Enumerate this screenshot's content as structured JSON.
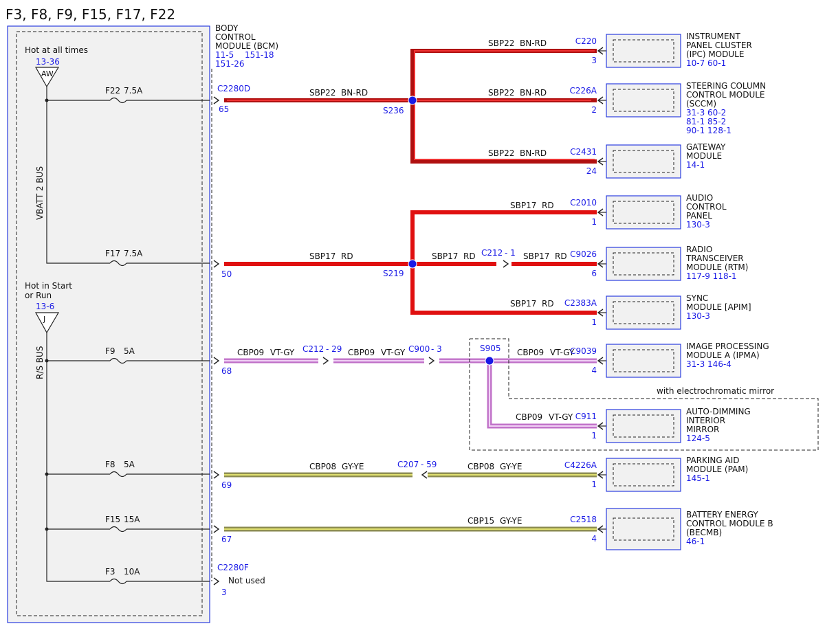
{
  "title": "F3, F8, F9, F15, F17, F22",
  "colors": {
    "wire_red_dark": "#b01010",
    "wire_red": "#e01010",
    "wire_vtgy": "#c070c8",
    "wire_gyye": "#9a9a3a",
    "splice": "#1a1ae6",
    "link": "#1a1ae6",
    "box_border": "#2b3ee0"
  },
  "fusebox": {
    "hot_at_all_times": "Hot at all times",
    "hot_at_all_times_ref": "13-36",
    "aw": "AW",
    "vbatt_bus": "VBATT 2 BUS",
    "hot_start_line1": "Hot in Start",
    "hot_start_line2": "or Run",
    "hot_start_ref": "13-6",
    "j": "J",
    "rs_bus": "R/S BUS"
  },
  "fuses": [
    {
      "name": "F22",
      "rating": "7.5A"
    },
    {
      "name": "F17",
      "rating": "7.5A"
    },
    {
      "name": "F9",
      "rating": "5A"
    },
    {
      "name": "F8",
      "rating": "5A"
    },
    {
      "name": "F15",
      "rating": "15A"
    },
    {
      "name": "F3",
      "rating": "10A"
    }
  ],
  "bcm": {
    "l1": "BODY",
    "l2": "CONTROL",
    "l3": "MODULE (BCM)",
    "ref1": "11-5",
    "ref2": "151-18",
    "ref3": "151-26",
    "conn_d": "C2280D",
    "conn_f": "C2280F",
    "not_used": "Not used",
    "pins": [
      "65",
      "50",
      "68",
      "69",
      "67",
      "3"
    ]
  },
  "wires": {
    "sbp22": "SBP22",
    "bnrd": "BN-RD",
    "sbp17": "SBP17",
    "rd": "RD",
    "cbp09": "CBP09",
    "vtgy": "VT-GY",
    "cbp08": "CBP08",
    "gyye": "GY-YE",
    "cbp15": "CBP15"
  },
  "splices": {
    "s236": "S236",
    "s219": "S219",
    "s905": "S905"
  },
  "inline": {
    "c212": "C212",
    "c212_pin1": "- 1",
    "c212_pin29": "- 29",
    "c900": "C900",
    "c900_pin": "- 3",
    "c207": "C207",
    "c207_pin": "- 59"
  },
  "option_note": "with electrochromatic mirror",
  "modules": [
    {
      "conn": "C220",
      "pin": "3",
      "lines": [
        "INSTRUMENT",
        "PANEL CLUSTER",
        "(IPC) MODULE"
      ],
      "refs": [
        "10-7   60-1"
      ]
    },
    {
      "conn": "C226A",
      "pin": "2",
      "lines": [
        "STEERING COLUMN",
        "CONTROL MODULE",
        "(SCCM)"
      ],
      "refs": [
        "31-3    60-2",
        "81-1    85-2",
        "90-1   128-1"
      ]
    },
    {
      "conn": "C2431",
      "pin": "24",
      "lines": [
        "GATEWAY",
        "MODULE"
      ],
      "refs": [
        "14-1"
      ]
    },
    {
      "conn": "C2010",
      "pin": "1",
      "lines": [
        "AUDIO",
        "CONTROL",
        "PANEL"
      ],
      "refs": [
        "130-3"
      ]
    },
    {
      "conn": "C9026",
      "pin": "6",
      "lines": [
        "RADIO",
        "TRANSCEIVER",
        "MODULE (RTM)"
      ],
      "refs": [
        "117-9  118-1"
      ]
    },
    {
      "conn": "C2383A",
      "pin": "1",
      "lines": [
        "SYNC",
        "MODULE [APIM]"
      ],
      "refs": [
        "130-3"
      ]
    },
    {
      "conn": "C9039",
      "pin": "4",
      "lines": [
        "IMAGE PROCESSING",
        "MODULE A (IPMA)"
      ],
      "refs": [
        "31-3    146-4"
      ]
    },
    {
      "conn": "C911",
      "pin": "1",
      "lines": [
        "AUTO-DIMMING",
        "INTERIOR",
        "MIRROR"
      ],
      "refs": [
        "124-5"
      ]
    },
    {
      "conn": "C4226A",
      "pin": "1",
      "lines": [
        "PARKING AID",
        "MODULE (PAM)"
      ],
      "refs": [
        "145-1"
      ]
    },
    {
      "conn": "C2518",
      "pin": "4",
      "lines": [
        "BATTERY ENERGY",
        "CONTROL MODULE B",
        "(BECMB)"
      ],
      "refs": [
        "46-1"
      ]
    }
  ]
}
